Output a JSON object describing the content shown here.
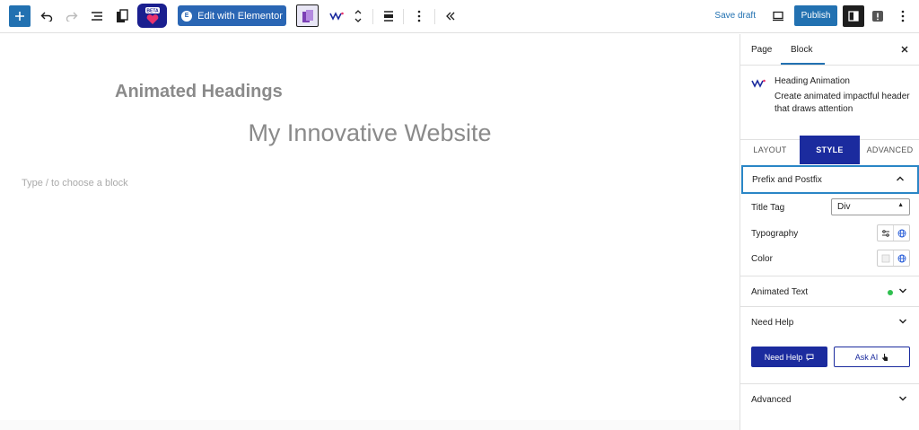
{
  "toolbar": {
    "beta_badge": "BETA",
    "elementor_label": "Edit with Elementor",
    "save_draft_label": "Save draft",
    "publish_label": "Publish"
  },
  "canvas": {
    "title": "Animated Headings",
    "heading": "My Innovative Website",
    "placeholder": "Type / to choose a block"
  },
  "sidebar": {
    "tabs": [
      "Page",
      "Block"
    ],
    "active_tab": "Block",
    "block": {
      "name": "Heading Animation",
      "description": "Create animated impactful header that draws attention"
    },
    "style_tabs": [
      "LAYOUT",
      "STYLE",
      "ADVANCED"
    ],
    "active_style_tab": "STYLE",
    "open_panel": {
      "title": "Prefix and Postfix",
      "title_tag_label": "Title Tag",
      "title_tag_value": "Div",
      "typography_label": "Typography",
      "color_label": "Color"
    },
    "panels": {
      "animated_text": "Animated Text",
      "need_help": "Need Help",
      "advanced": "Advanced"
    },
    "buttons": {
      "need_help": "Need Help",
      "ask_ai": "Ask AI"
    }
  },
  "colors": {
    "wp_blue": "#2271b1",
    "brand_navy": "#1b2b9e",
    "focus_blue": "#2a86c6",
    "status_green": "#2fbf4f"
  }
}
